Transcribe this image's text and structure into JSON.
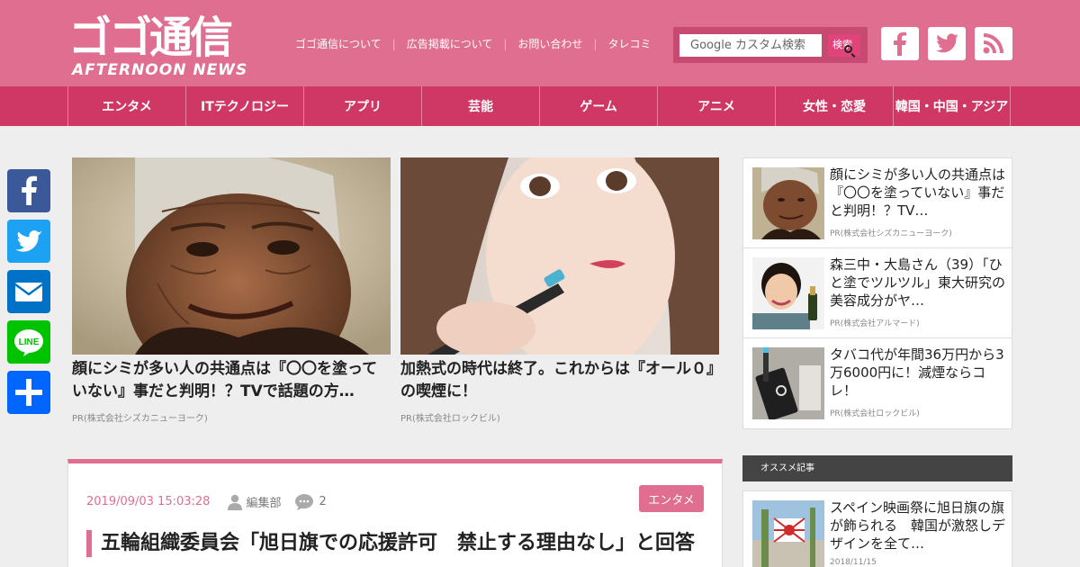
{
  "header": {
    "logo_main": "ゴゴ通信",
    "logo_sub": "AFTERNOON NEWS",
    "links": [
      "ゴゴ通信について",
      "広告掲載について",
      "お問い合わせ",
      "タレコミ"
    ],
    "search_placeholder": "Google カスタム検索",
    "search_button": "検索"
  },
  "nav": [
    "エンタメ",
    "ITテクノロジー",
    "アプリ",
    "芸能",
    "ゲーム",
    "アニメ",
    "女性・恋愛",
    "韓国・中国・アジア"
  ],
  "features": [
    {
      "title": "顔にシミが多い人の共通点は『〇〇を塗っていない』事だと判明！？TVで話題の方…",
      "pr": "PR(株式会社シズカニューヨーク)"
    },
    {
      "title": "加熱式の時代は終了。これからは『オール０』の喫煙に！",
      "pr": "PR(株式会社ロックビル)"
    }
  ],
  "article": {
    "date": "2019/09/03 15:03:28",
    "author": "編集部",
    "comments": "2",
    "category": "エンタメ",
    "title": "五輪組織委員会「旭日旗での応援許可　禁止する理由なし」と回答"
  },
  "sidebar": [
    {
      "title": "顔にシミが多い人の共通点は『〇〇を塗っていない』事だと判明！？TV…",
      "pr": "PR(株式会社シズカニューヨーク)"
    },
    {
      "title": "森三中・大島さん（39）「ひと塗でツルツル」東大研究の美容成分がヤ…",
      "pr": "PR(株式会社アルマード)"
    },
    {
      "title": "タバコ代が年間36万円から3万6000円に！減煙ならコレ！",
      "pr": "PR(株式会社ロックビル)"
    }
  ],
  "recommend": {
    "heading": "オススメ記事",
    "title": "スペイン映画祭に旭日旗の旗が飾られる　韓国が激怒しデザインを全て…",
    "date": "2018/11/15"
  },
  "colors": {
    "header": "#df6e90",
    "nav": "#cf3865",
    "accent": "#df6e90"
  }
}
